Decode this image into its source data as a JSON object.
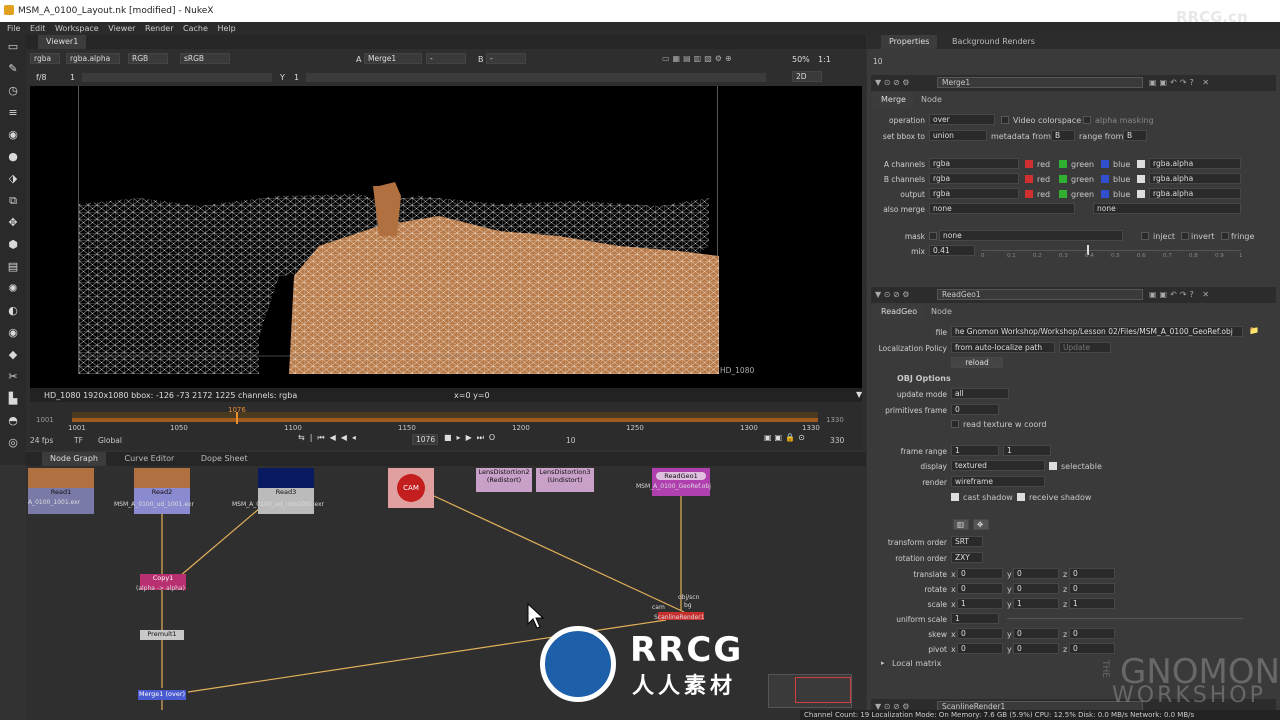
{
  "window": {
    "title": "MSM_A_0100_Layout.nk [modified] - NukeX"
  },
  "menu": [
    "File",
    "Edit",
    "Workspace",
    "Viewer",
    "Render",
    "Cache",
    "Help"
  ],
  "viewer": {
    "tab": "Viewer1",
    "channels": "rgba",
    "alpha": "rgba.alpha",
    "display": "RGB",
    "colorspace": "sRGB",
    "input_a": "A",
    "input_a_node": "Merge1",
    "input_b": "B",
    "zoom": "50%",
    "ratio": "1:1",
    "mode": "2D",
    "fstop": "f/8",
    "frame_field": "1",
    "y_label": "Y",
    "y_value": "1",
    "format_label": "HD_1080",
    "info": "HD_1080 1920x1080  bbox: -126 -73 2172 1225 channels: rgba",
    "coords": "x=0 y=0"
  },
  "timeline": {
    "ticks": [
      "1001",
      "1050",
      "1100",
      "1150",
      "1200",
      "1250",
      "1300",
      "1330"
    ],
    "current": "1076",
    "start": "1001",
    "end": "1330",
    "fps": "24 fps",
    "tf": "TF",
    "global": "Global",
    "frame": "1076",
    "step": "10",
    "end_field": "330"
  },
  "nodegraph": {
    "tabs": [
      "Node Graph",
      "Curve Editor",
      "Dope Sheet"
    ],
    "nodes": {
      "read1": "Read1",
      "read1_file": "A_0100_1001.exr",
      "read2": "Read2",
      "read2_file": "MSM_A_0100_ud_1001.exr",
      "read3": "Read3",
      "read3_file": "MSM_A_0100_ud_roto1001.exr",
      "cam": "CAM",
      "lens2": "LensDistortion2",
      "lens2_sub": "(Redistort)",
      "lens3": "LensDistortion3",
      "lens3_sub": "(Undistort)",
      "readgeo": "ReadGeo1",
      "readgeo_file": "MSM_A_0100_GeoRef.obj",
      "copy": "Copy1",
      "copy_sub": "(alpha -> alpha)",
      "premult": "Premult1",
      "merge": "Merge1 (over)",
      "scanline": "ScanlineRender1",
      "scanline_cam": "cam",
      "scanline_obj": "obj/scn",
      "scanline_bg": "bg"
    }
  },
  "properties": {
    "tabs": [
      "Properties",
      "Background Renders"
    ],
    "max_panels": "10",
    "merge": {
      "title": "Merge1",
      "tabs": [
        "Merge",
        "Node"
      ],
      "operation_label": "operation",
      "operation": "over",
      "video_colorspace": "Video colorspace",
      "alpha_masking": "alpha masking",
      "bbox_label": "set bbox to",
      "bbox": "union",
      "metadata_label": "metadata from",
      "metadata": "B",
      "range_label": "range from",
      "range": "B",
      "a_channels_label": "A channels",
      "b_channels_label": "B channels",
      "output_label": "output",
      "channels_val": "rgba",
      "red": "red",
      "green": "green",
      "blue": "blue",
      "alpha_val": "rgba.alpha",
      "also_merge_label": "also merge",
      "also_merge": "none",
      "also_merge2": "none",
      "mask_label": "mask",
      "mask": "none",
      "inject": "inject",
      "invert": "invert",
      "fringe": "fringe",
      "mix_label": "mix",
      "mix": "0.41",
      "mix_ticks": [
        "0",
        "0.1",
        "0.2",
        "0.3",
        "0.4",
        "0.5",
        "0.6",
        "0.7",
        "0.8",
        "0.9",
        "1"
      ]
    },
    "readgeo": {
      "title": "ReadGeo1",
      "tabs": [
        "ReadGeo",
        "Node"
      ],
      "file_label": "file",
      "file": "he Gnomon Workshop/Workshop/Lesson 02/Files/MSM_A_0100_GeoRef.obj",
      "loc_label": "Localization Policy",
      "loc": "from auto-localize path",
      "update_btn": "Update",
      "reload": "reload",
      "obj_options": "OBJ Options",
      "update_mode_label": "update mode",
      "update_mode": "all",
      "prim_label": "primitives frame",
      "prim": "0",
      "read_texture": "read texture w coord",
      "frame_range_label": "frame range",
      "fr1": "1",
      "fr2": "1",
      "display_label": "display",
      "display": "textured",
      "selectable": "selectable",
      "render_label": "render",
      "render": "wireframe",
      "cast_shadow": "cast shadow",
      "receive_shadow": "receive shadow",
      "transform_label": "transform order",
      "transform": "SRT",
      "rotation_label": "rotation order",
      "rotation": "ZXY",
      "translate_label": "translate",
      "rotate_label": "rotate",
      "scale_label": "scale",
      "uniform_label": "uniform scale",
      "uniform": "1",
      "skew_label": "skew",
      "pivot_label": "pivot",
      "x": "x",
      "y": "y",
      "z": "z",
      "zero": "0",
      "one": "1",
      "local_matrix": "Local matrix"
    },
    "scanline": {
      "title": "ScanlineRender1"
    }
  },
  "status": "Channel Count: 19  Localization Mode: On  Memory: 7.6 GB (5.9%)  CPU: 12.5%  Disk: 0.0 MB/s  Network: 0.0 MB/s",
  "watermark": {
    "rrcg_small": "RRCG.cn",
    "rrcg": "RRCG",
    "rrcg_cn": "人人素材",
    "gnomon1": "GNOMON",
    "gnomon2": "WORKSHOP",
    "the": "THE"
  }
}
